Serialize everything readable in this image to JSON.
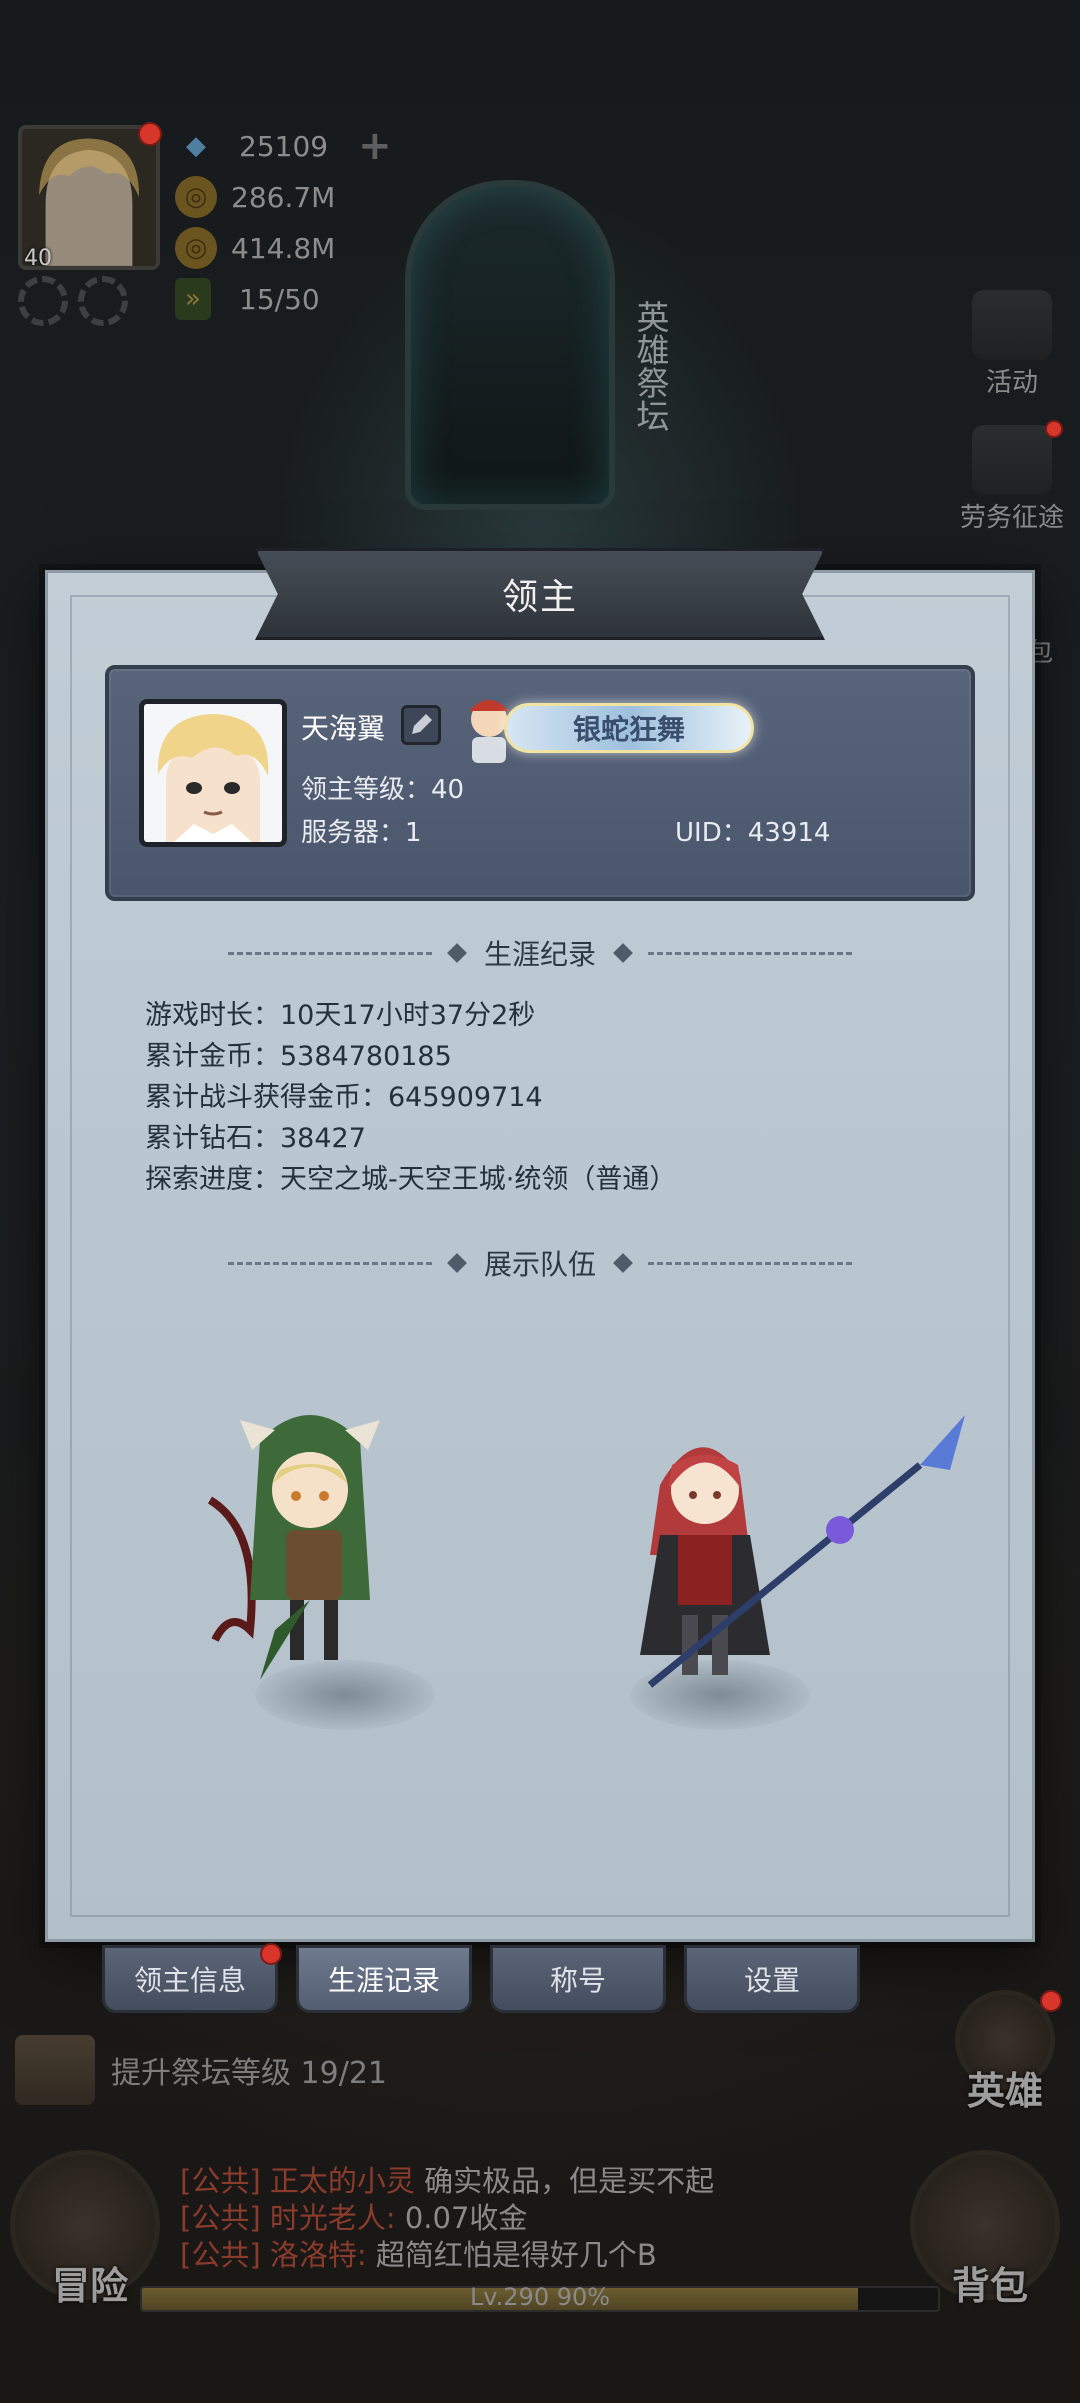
{
  "altar_label": "英雄祭坛",
  "player": {
    "level": "40"
  },
  "resources": {
    "diamonds": "25109",
    "gold_1": "286.7M",
    "gold_2": "414.8M",
    "stamina": "15/50"
  },
  "side_menu": {
    "activity": "活动",
    "expedition": "劳务征途",
    "bag_partial": "包"
  },
  "modal": {
    "title": "领主",
    "profile": {
      "name": "天海翼",
      "title_badge": "银蛇狂舞",
      "lord_level": "领主等级：40",
      "server": "服务器：1",
      "uid": "UID：43914"
    },
    "career_header": "生涯纪录",
    "stats": [
      "游戏时长：10天17小时37分2秒",
      "累计金币：5384780185",
      "累计战斗获得金币：645909714",
      "累计钻石：38427",
      "探索进度：天空之城-天空王城·统领（普通）"
    ],
    "team_header": "展示队伍"
  },
  "tabs": [
    {
      "label": "领主信息",
      "active": false
    },
    {
      "label": "生涯记录",
      "active": true
    },
    {
      "label": "称号",
      "active": false
    },
    {
      "label": "设置",
      "active": false
    }
  ],
  "quest": {
    "text": "提升祭坛等级 19/21"
  },
  "chat": [
    {
      "channel": "[公共]",
      "user": "正太的小灵",
      "msg": "确实极品，但是买不起"
    },
    {
      "channel": "[公共]",
      "user": "时光老人:",
      "msg": "0.07收金"
    },
    {
      "channel": "[公共]",
      "user": "洛洛特:",
      "msg": "超简红怕是得好几个B"
    }
  ],
  "bottom": {
    "adventure": "冒险",
    "hero": "英雄",
    "bag": "背包",
    "xp_label": "Lv.290  90%",
    "xp_progress": 0.9
  },
  "colors": {
    "modal_bg": "#bac6d0",
    "card_bg": "#525e73",
    "chat_name": "#8a3b2c",
    "badge_red": "#d9362b"
  }
}
